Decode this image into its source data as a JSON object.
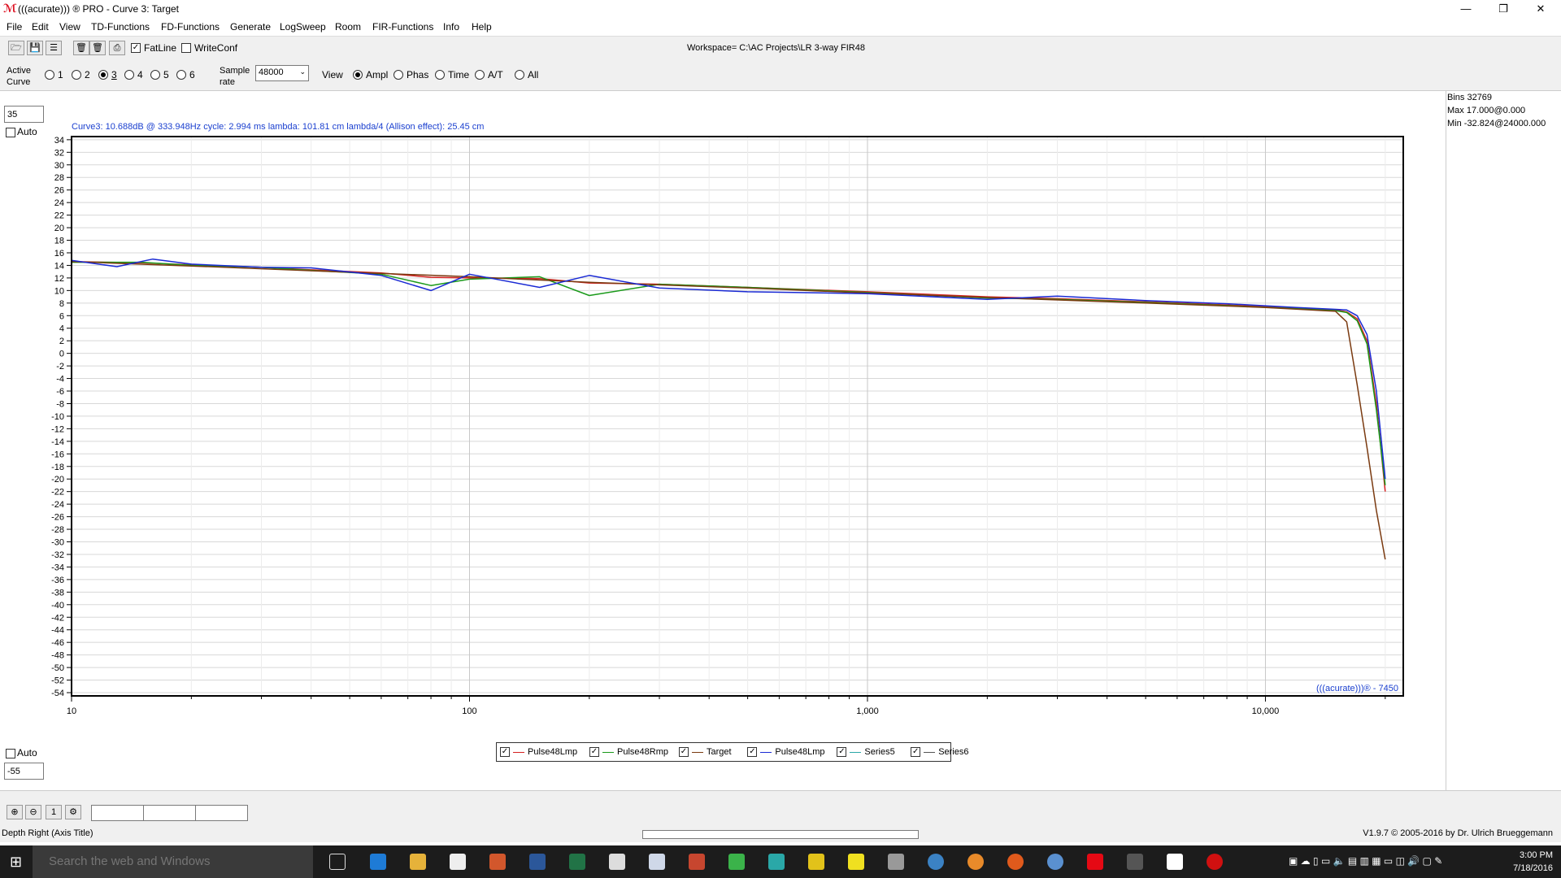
{
  "window": {
    "title": "(((acurate))) ® PRO - Curve 3: Target",
    "app_icon": "acourate-logo-icon"
  },
  "menu": [
    "File",
    "Edit",
    "View",
    "TD-Functions",
    "FD-Functions",
    "Generate",
    "LogSweep",
    "Room",
    "FIR-Functions",
    "Info",
    "Help"
  ],
  "toolbar": {
    "fatline_label": "FatLine",
    "fatline_checked": true,
    "writeconf_label": "WriteConf",
    "writeconf_checked": false,
    "workspace": "Workspace= C:\\AC Projects\\LR 3-way FIR48"
  },
  "controls": {
    "active_curve_label": "Active Curve",
    "curves": [
      "1",
      "2",
      "3",
      "4",
      "5",
      "6"
    ],
    "active_curve": "3",
    "sample_rate_label": "Sample rate",
    "sample_rate": "48000",
    "view_label": "View",
    "views": [
      "Ampl",
      "Phas",
      "Time",
      "A/T",
      "All"
    ],
    "active_view": "Ampl"
  },
  "plot": {
    "ymax_value": "35",
    "ymin_value": "-55",
    "auto_label": "Auto",
    "info_line": "Curve3:  10.688dB @ 333.948Hz   cycle: 2.994 ms   lambda: 101.81 cm   lambda/4 (Allison effect): 25.45 cm",
    "watermark": "(((acurate)))® - 7450"
  },
  "stats": {
    "bins": "Bins 32769",
    "max": "Max 17.000@0.000",
    "min": "Min -32.824@24000.000"
  },
  "bottom": {
    "axis_title": "Depth Right (Axis Title)",
    "version": "V1.9.7 © 2005-2016 by Dr. Ulrich Brueggemann",
    "zoom_reset": "1"
  },
  "taskbar": {
    "search_placeholder": "Search the web and Windows",
    "time": "3:00 PM",
    "date": "7/18/2016"
  },
  "chart_data": {
    "type": "line",
    "xscale": "log",
    "xlim": [
      10,
      24000
    ],
    "ylim": [
      -55,
      35
    ],
    "xticks": [
      "10",
      "100",
      "1,000",
      "10,000"
    ],
    "yticks": [
      34,
      32,
      30,
      28,
      26,
      24,
      22,
      20,
      18,
      16,
      14,
      12,
      10,
      8,
      6,
      4,
      2,
      0,
      -2,
      -4,
      -6,
      -8,
      -10,
      -12,
      -14,
      -16,
      -18,
      -20,
      -22,
      -24,
      -26,
      -28,
      -30,
      -32,
      -34,
      -36,
      -38,
      -40,
      -42,
      -44,
      -46,
      -48,
      -50,
      -52,
      -54
    ],
    "grid": true,
    "legend_position": "bottom-center",
    "series": [
      {
        "name": "Pulse48Lmp",
        "color": "#d42020",
        "x": [
          10,
          15,
          20,
          30,
          40,
          60,
          80,
          100,
          150,
          200,
          300,
          500,
          1000,
          2000,
          3000,
          5000,
          8000,
          12000,
          15000,
          16000,
          17000,
          18000,
          19000,
          20000
        ],
        "y": [
          14.6,
          14.4,
          14.1,
          13.7,
          13.3,
          12.8,
          12.1,
          12.0,
          11.9,
          11.2,
          11.0,
          10.5,
          9.8,
          9.0,
          8.7,
          8.2,
          7.7,
          7.2,
          6.9,
          6.6,
          5.5,
          2.0,
          -8.0,
          -22.0
        ]
      },
      {
        "name": "Pulse48Rmp",
        "color": "#1a9a1a",
        "x": [
          10,
          15,
          20,
          30,
          40,
          60,
          80,
          100,
          150,
          200,
          300,
          500,
          1000,
          2000,
          3000,
          5000,
          8000,
          12000,
          15000,
          16000,
          17000,
          18000,
          19000,
          20000
        ],
        "y": [
          14.5,
          14.5,
          14.0,
          13.7,
          13.2,
          12.6,
          10.8,
          11.8,
          12.2,
          9.2,
          11.0,
          10.5,
          9.7,
          8.8,
          8.6,
          8.1,
          7.6,
          7.1,
          6.8,
          6.5,
          5.2,
          1.5,
          -9.0,
          -21.0
        ]
      },
      {
        "name": "Target",
        "color": "#7a3a10",
        "x": [
          10,
          20,
          50,
          100,
          200,
          500,
          1000,
          2000,
          5000,
          10000,
          14000,
          15000,
          16000,
          17000,
          18000,
          19000,
          20000
        ],
        "y": [
          14.6,
          13.9,
          12.9,
          12.2,
          11.3,
          10.4,
          9.6,
          8.9,
          8.0,
          7.3,
          6.8,
          6.7,
          5.0,
          -5.0,
          -15.0,
          -25.0,
          -32.8
        ]
      },
      {
        "name": "Pulse48Lmp",
        "color": "#1a2ad4",
        "x": [
          10,
          13,
          16,
          20,
          30,
          40,
          60,
          80,
          100,
          150,
          200,
          300,
          500,
          1000,
          2000,
          3000,
          5000,
          8000,
          12000,
          15000,
          16000,
          17000,
          18000,
          19000,
          20000
        ],
        "y": [
          14.8,
          13.8,
          15.0,
          14.2,
          13.7,
          13.6,
          12.4,
          10.0,
          12.6,
          10.5,
          12.4,
          10.4,
          9.8,
          9.5,
          8.6,
          9.1,
          8.4,
          7.9,
          7.3,
          7.0,
          6.9,
          6.0,
          3.0,
          -6.0,
          -20.0
        ]
      },
      {
        "name": "Series5",
        "color": "#2aa8a8",
        "x": [],
        "y": []
      },
      {
        "name": "Series6",
        "color": "#555555",
        "x": [],
        "y": []
      }
    ]
  }
}
